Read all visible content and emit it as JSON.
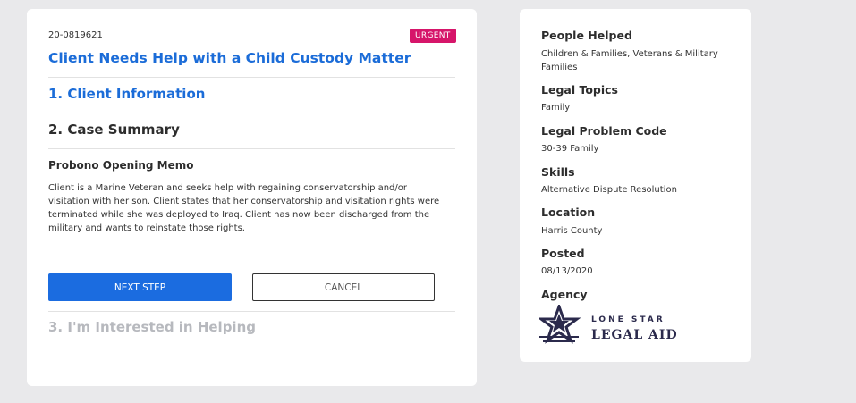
{
  "case": {
    "id": "20-0819621",
    "badge": "URGENT",
    "title": "Client Needs Help with a Child Custody Matter"
  },
  "steps": {
    "step1": "1. Client Information",
    "step2": "2. Case Summary",
    "step3": "3. I'm Interested in Helping"
  },
  "memo": {
    "title": "Probono Opening Memo",
    "text": "Client is a Marine Veteran and seeks help with regaining conservatorship and/or visitation with her son.  Client states that her conservatorship and visitation rights were terminated while she was deployed to Iraq.  Client has now been discharged from the military and wants to reinstate those rights."
  },
  "buttons": {
    "next": "NEXT STEP",
    "cancel": "CANCEL"
  },
  "details": {
    "people_helped_label": "People Helped",
    "people_helped": "Children & Families, Veterans & Military Families",
    "legal_topics_label": "Legal Topics",
    "legal_topics": "Family",
    "problem_code_label": "Legal Problem Code",
    "problem_code": "30-39 Family",
    "skills_label": "Skills",
    "skills": "Alternative Dispute Resolution",
    "location_label": "Location",
    "location": "Harris County",
    "posted_label": "Posted",
    "posted": "08/13/2020",
    "agency_label": "Agency",
    "agency_logo_line1": "LONE STAR",
    "agency_logo_line2": "LEGAL AID",
    "logo_color": "#2b2a4c"
  },
  "colors": {
    "accent": "#1b6cd8",
    "badge": "#d6156a",
    "disabled": "#b7b9be"
  }
}
